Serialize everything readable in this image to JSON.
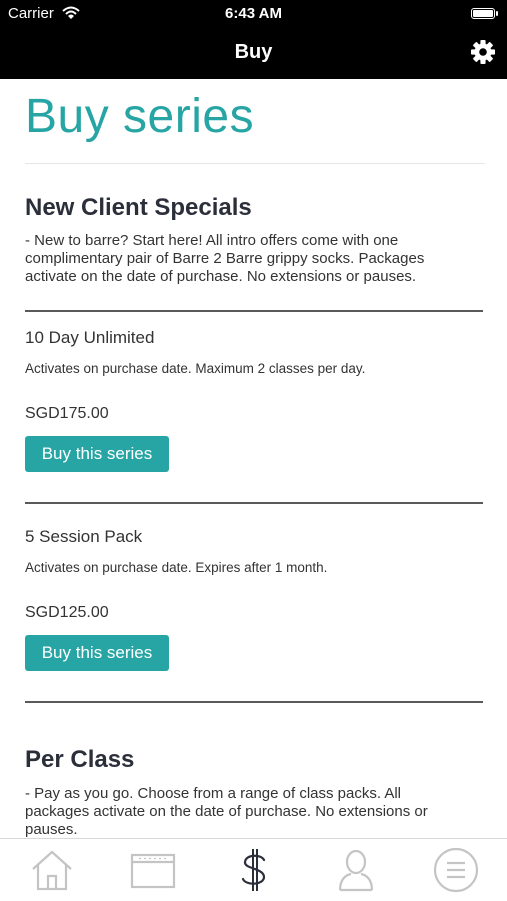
{
  "status_bar": {
    "carrier": "Carrier",
    "time": "6:43 AM"
  },
  "nav": {
    "title": "Buy",
    "settings_icon": "gear-icon"
  },
  "page": {
    "title": "Buy series"
  },
  "sections": [
    {
      "title": "New Client Specials",
      "description": "- New to barre? Start here! All intro offers come with one complimentary pair of Barre 2 Barre grippy socks. Packages activate on the date of purchase. No extensions or pauses.",
      "items": [
        {
          "name": "10 Day Unlimited",
          "description": "Activates on purchase date. Maximum 2 classes per day.",
          "price": "SGD175.00",
          "button_label": "Buy this series"
        },
        {
          "name": "5 Session Pack",
          "description": "Activates on purchase date. Expires after 1 month.",
          "price": "SGD125.00",
          "button_label": "Buy this series"
        }
      ]
    },
    {
      "title": "Per Class",
      "description": "- Pay as you go. Choose from a range of class packs. All packages activate on the date of purchase. No extensions or pauses.",
      "items": []
    }
  ],
  "tabbar": {
    "tabs": [
      {
        "icon": "home-icon",
        "active": false
      },
      {
        "icon": "schedule-icon",
        "active": false
      },
      {
        "icon": "dollar-icon",
        "active": true
      },
      {
        "icon": "profile-icon",
        "active": false
      },
      {
        "icon": "menu-icon",
        "active": false
      }
    ]
  },
  "colors": {
    "accent": "#26a5a4",
    "bar": "#000000",
    "tab_icon": "#c4c4c4",
    "tab_icon_active": "#2b2f3a"
  }
}
